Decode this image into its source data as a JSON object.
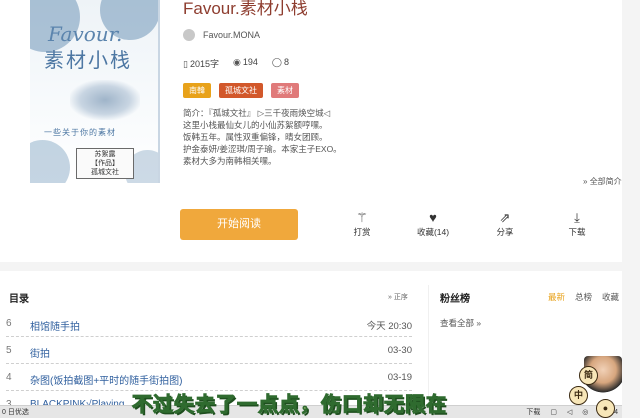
{
  "book": {
    "title": "Favour.素材小栈",
    "author": "Favour.MONA",
    "words": "2015字",
    "views": "194",
    "comments": "8",
    "tags": [
      {
        "label": "南韓",
        "color": "#e8a21a"
      },
      {
        "label": "孤城文社",
        "color": "#d2582b"
      },
      {
        "label": "素材",
        "color": "#e07a7a"
      }
    ],
    "intro_lines": [
      "简介：『孤城文社』 ▷三千夜雨焕空城◁",
      "这里小栈最仙女儿的小仙苏絮额哼嘿。",
      "饭韩五年。属性双重偏锋，晴女团顾。",
      "护金泰妍/姜涩琪/周子瑜。本家主子EXO。",
      "素材大多为南韩相关嘿。"
    ],
    "expand_label": "全部简介"
  },
  "cover": {
    "title_en": "Favour.",
    "title_cn": "素材小栈",
    "subtitle": "一些关于你的素材",
    "stamp_line1": "苏絮露",
    "stamp_line2": "【作品】",
    "stamp_line3": "孤城文社"
  },
  "actions": {
    "read_label": "开始阅读",
    "reward_label": "打赏",
    "favorite_label": "收藏(14)",
    "share_label": "分享",
    "download_label": "下载"
  },
  "toc": {
    "title": "目录",
    "sort_label": "正序",
    "chapters": [
      {
        "num": "6",
        "name": "相馆随手拍",
        "date": "今天 20:30"
      },
      {
        "num": "5",
        "name": "街拍",
        "date": "03-30"
      },
      {
        "num": "4",
        "name": "杂图(饭拍截图+平时的随手街拍图)",
        "date": "03-19"
      },
      {
        "num": "3",
        "name": "BLACKPINK√Playing",
        "date": ""
      }
    ]
  },
  "fans": {
    "title": "粉丝榜",
    "tabs": [
      {
        "label": "最新",
        "active": true
      },
      {
        "label": "总榜",
        "active": false
      },
      {
        "label": "收藏",
        "active": false
      }
    ],
    "view_all": "查看全部 »"
  },
  "overlay": {
    "subtitle_text": "不过失去了一点点，伤口却无限在",
    "taskbar_left": "0 日优选",
    "taskbar_right": "下载 ▢ ◁ ◎ ⊡ 4"
  },
  "colors": {
    "accent_orange": "#f0a83c",
    "title_red": "#8e3d2f",
    "link_blue": "#2f5f9e",
    "tab_active": "#e8a21a"
  }
}
